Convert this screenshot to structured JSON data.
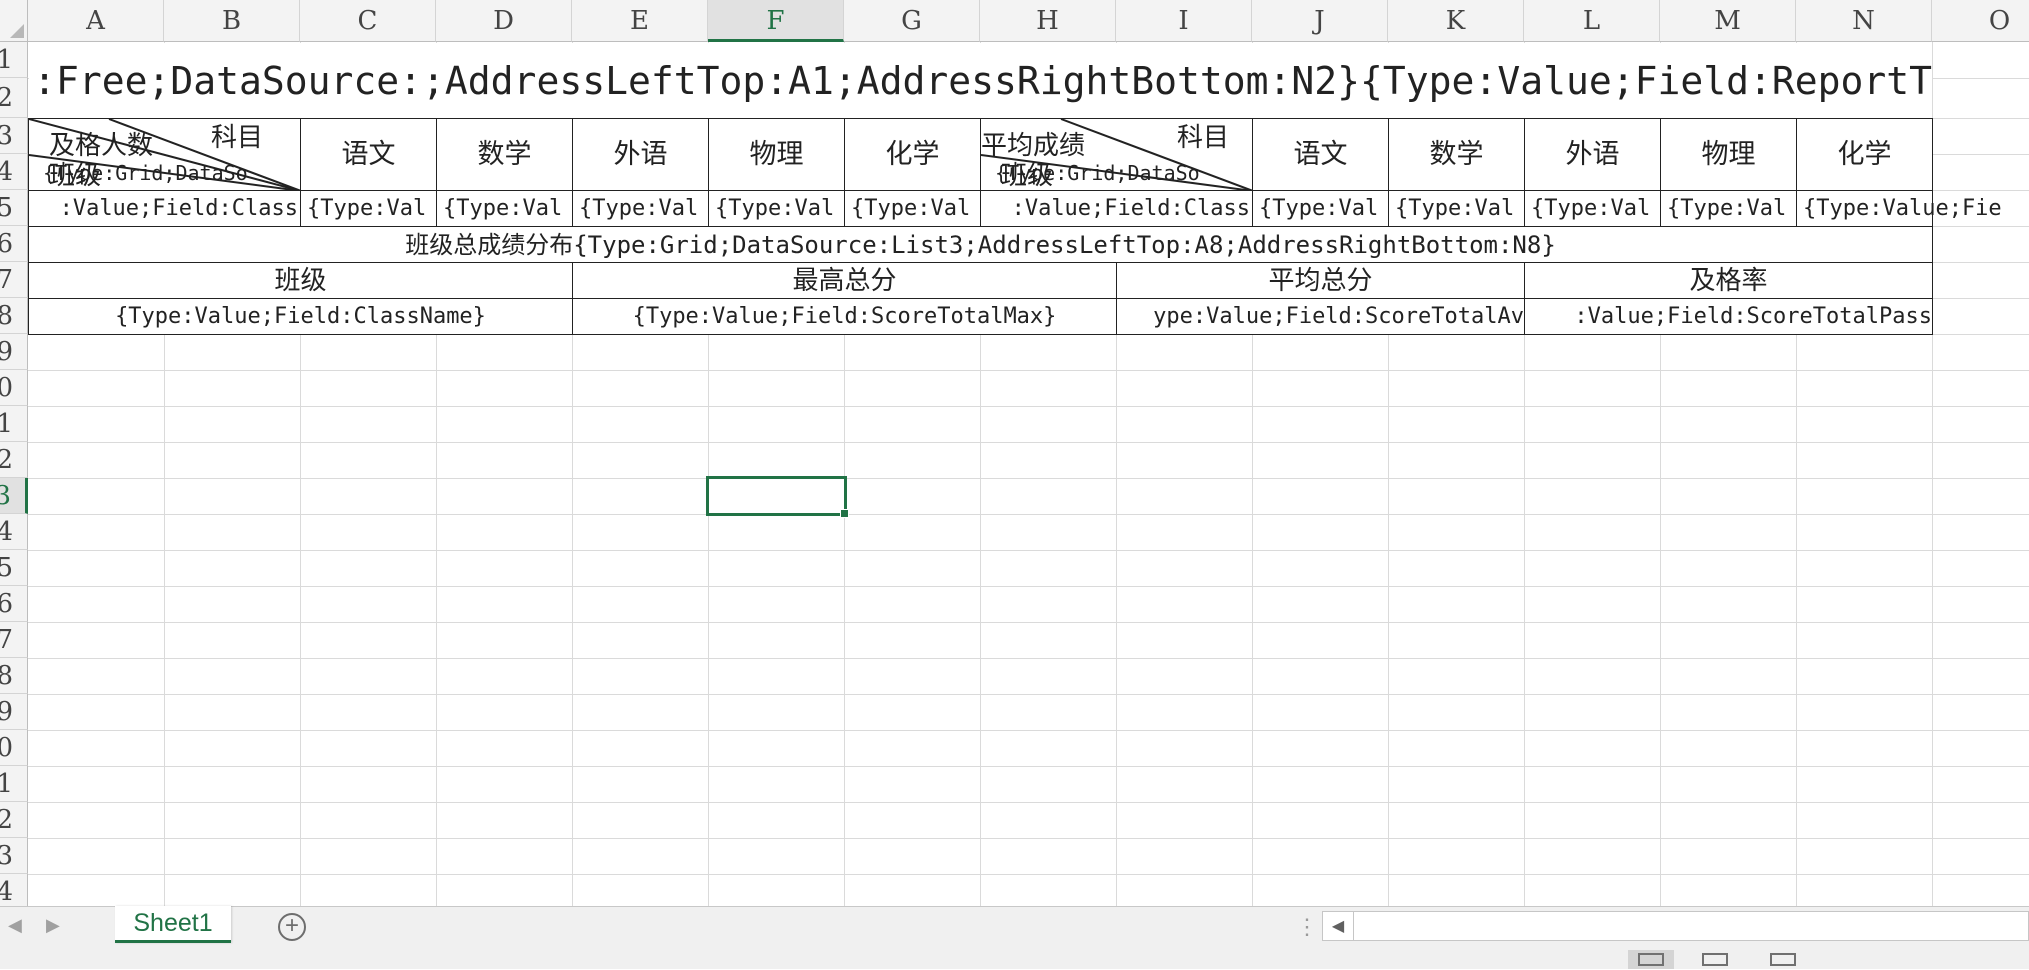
{
  "columns": [
    {
      "label": "A"
    },
    {
      "label": "B"
    },
    {
      "label": "C"
    },
    {
      "label": "D"
    },
    {
      "label": "E"
    },
    {
      "label": "F"
    },
    {
      "label": "G"
    },
    {
      "label": "H"
    },
    {
      "label": "I"
    },
    {
      "label": "J"
    },
    {
      "label": "K"
    },
    {
      "label": "L"
    },
    {
      "label": "M"
    },
    {
      "label": "N"
    },
    {
      "label": "O"
    }
  ],
  "rows": [
    {
      "label": "1"
    },
    {
      "label": "2"
    },
    {
      "label": "3"
    },
    {
      "label": "4"
    },
    {
      "label": "5"
    },
    {
      "label": "6"
    },
    {
      "label": "7"
    },
    {
      "label": "8"
    },
    {
      "label": "9"
    },
    {
      "label": "10"
    },
    {
      "label": "11"
    },
    {
      "label": "12"
    },
    {
      "label": "13"
    },
    {
      "label": "14"
    },
    {
      "label": "15"
    },
    {
      "label": "16"
    },
    {
      "label": "17"
    },
    {
      "label": "18"
    },
    {
      "label": "19"
    },
    {
      "label": "20"
    },
    {
      "label": "21"
    },
    {
      "label": "22"
    },
    {
      "label": "23"
    },
    {
      "label": "24"
    }
  ],
  "selected": {
    "column": "F",
    "row": "13"
  },
  "cells": {
    "title": ":Free;DataSource:;AddressLeftTop:A1;AddressRightBottom:N2}{Type:Value;Field:ReportT",
    "left_table": {
      "diag_top": "科目",
      "diag_mid": "及格人数",
      "diag_bottom": "班级",
      "diag_tag": "{Type:Grid;DataSo",
      "headers": [
        "语文",
        "数学",
        "外语",
        "物理",
        "化学"
      ],
      "row5_first": ":Value;Field:Class",
      "row5_values": [
        "{Type:Val",
        "{Type:Val",
        "{Type:Val",
        "{Type:Val",
        "{Type:Val"
      ]
    },
    "right_table": {
      "diag_top": "科目",
      "diag_mid": "平均成绩",
      "diag_bottom": "班级",
      "diag_tag": "{Type:Grid;DataSo",
      "headers": [
        "语文",
        "数学",
        "外语",
        "物理",
        "化学"
      ],
      "row5_first": ":Value;Field:Class",
      "row5_values": [
        "{Type:Val",
        "{Type:Val",
        "{Type:Val",
        "{Type:Val",
        "{Type:Value;Fie"
      ]
    },
    "summary": {
      "caption": "班级总成绩分布{Type:Grid;DataSource:List3;AddressLeftTop:A8;AddressRightBottom:N8}",
      "headers": [
        "班级",
        "最高总分",
        "平均总分",
        "及格率"
      ],
      "values": [
        "{Type:Value;Field:ClassName}",
        "{Type:Value;Field:ScoreTotalMax}",
        "ype:Value;Field:ScoreTotalAv",
        ":Value;Field:ScoreTotalPass"
      ]
    }
  },
  "sheet_tabs": [
    {
      "name": "Sheet1",
      "active": true
    }
  ],
  "colors": {
    "accent": "#217346",
    "grid": "#dadada",
    "header_bg": "#f3f3f3"
  }
}
